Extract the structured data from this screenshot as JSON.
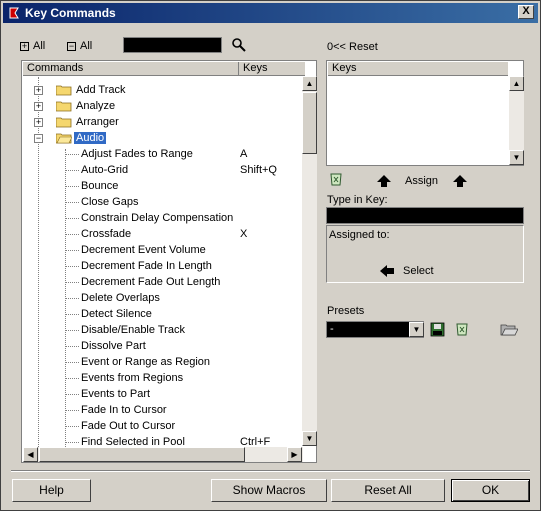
{
  "window": {
    "title": "Key Commands",
    "close_label": "X"
  },
  "toolbar": {
    "expand_all": "All",
    "collapse_all": "All",
    "search_value": "",
    "reset_label": "Reset",
    "reset_prefix": "0<<"
  },
  "tree": {
    "header_commands": "Commands",
    "header_keys": "Keys",
    "folders": [
      {
        "label": "Add Track",
        "expanded": false
      },
      {
        "label": "Analyze",
        "expanded": false
      },
      {
        "label": "Arranger",
        "expanded": false
      },
      {
        "label": "Audio",
        "expanded": true,
        "selected": true
      }
    ],
    "commands": [
      {
        "label": "Adjust Fades to Range",
        "key": "A"
      },
      {
        "label": "Auto-Grid",
        "key": "Shift+Q"
      },
      {
        "label": "Bounce",
        "key": ""
      },
      {
        "label": "Close Gaps",
        "key": ""
      },
      {
        "label": "Constrain Delay Compensation",
        "key": ""
      },
      {
        "label": "Crossfade",
        "key": "X"
      },
      {
        "label": "Decrement Event Volume",
        "key": ""
      },
      {
        "label": "Decrement Fade In Length",
        "key": ""
      },
      {
        "label": "Decrement Fade Out Length",
        "key": ""
      },
      {
        "label": "Delete Overlaps",
        "key": ""
      },
      {
        "label": "Detect Silence",
        "key": ""
      },
      {
        "label": "Disable/Enable Track",
        "key": ""
      },
      {
        "label": "Dissolve Part",
        "key": ""
      },
      {
        "label": "Event or Range as Region",
        "key": ""
      },
      {
        "label": "Events from Regions",
        "key": ""
      },
      {
        "label": "Events to Part",
        "key": ""
      },
      {
        "label": "Fade In to Cursor",
        "key": ""
      },
      {
        "label": "Fade Out to Cursor",
        "key": ""
      },
      {
        "label": "Find Selected in Pool",
        "key": "Ctrl+F"
      }
    ]
  },
  "right": {
    "keys_header": "Keys",
    "assign_label": "Assign",
    "type_in_key_label": "Type in Key:",
    "type_in_key_value": "",
    "assigned_to_label": "Assigned to:",
    "select_label": "Select",
    "presets_label": "Presets",
    "presets_value": "-"
  },
  "buttons": {
    "help": "Help",
    "show_macros": "Show Macros",
    "reset_all": "Reset All",
    "ok": "OK"
  }
}
